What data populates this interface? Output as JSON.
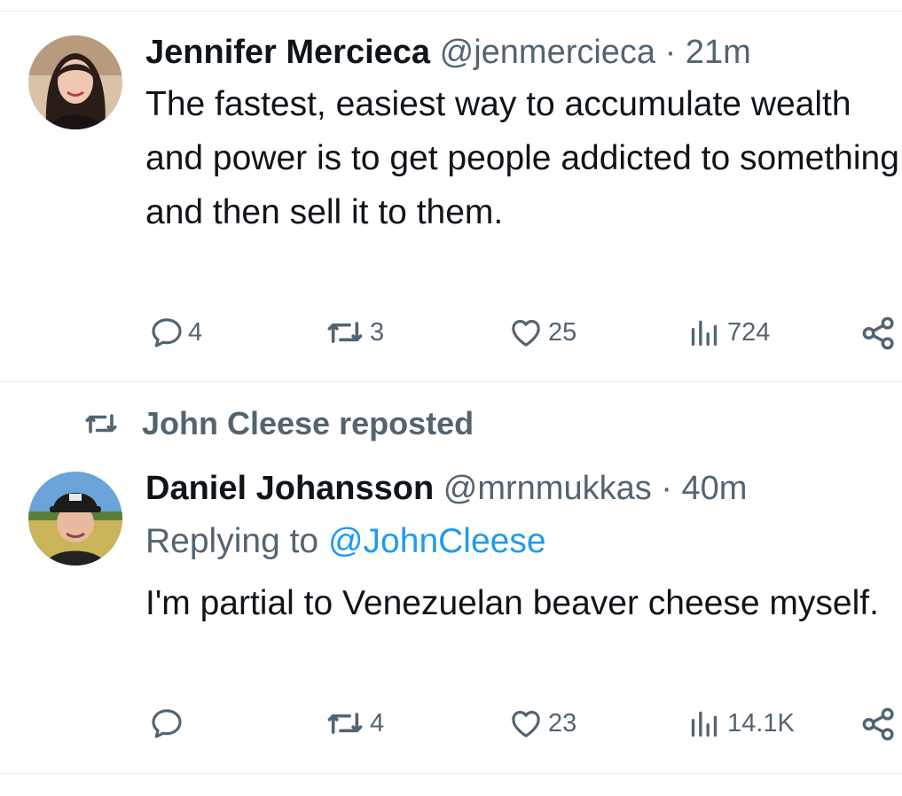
{
  "tweet1": {
    "name": "Jennifer Mercieca",
    "handle": "@jenmercieca",
    "separator": "·",
    "time": "21m",
    "text": "The fastest, easiest way to accumulate wealth and power is to get people addicted to something and then sell it to them.",
    "replies": "4",
    "reposts": "3",
    "likes": "25",
    "views": "724"
  },
  "repost_banner": {
    "text": "John Cleese reposted"
  },
  "tweet2": {
    "name": "Daniel Johansson",
    "handle": "@mrnmukkas",
    "separator": "·",
    "time": "40m",
    "replying_prefix": "Replying to",
    "replying_mention": "@JohnCleese",
    "text": "I'm partial to Venezuelan beaver cheese myself.",
    "replies": "",
    "reposts": "4",
    "likes": "23",
    "views": "14.1K"
  },
  "colors": {
    "text": "#0f1419",
    "secondary": "#536471",
    "accent": "#1d9bf0",
    "divider": "#e6ecf0"
  },
  "icons": [
    "reply-icon",
    "repost-icon",
    "like-icon",
    "views-icon",
    "share-icon"
  ]
}
